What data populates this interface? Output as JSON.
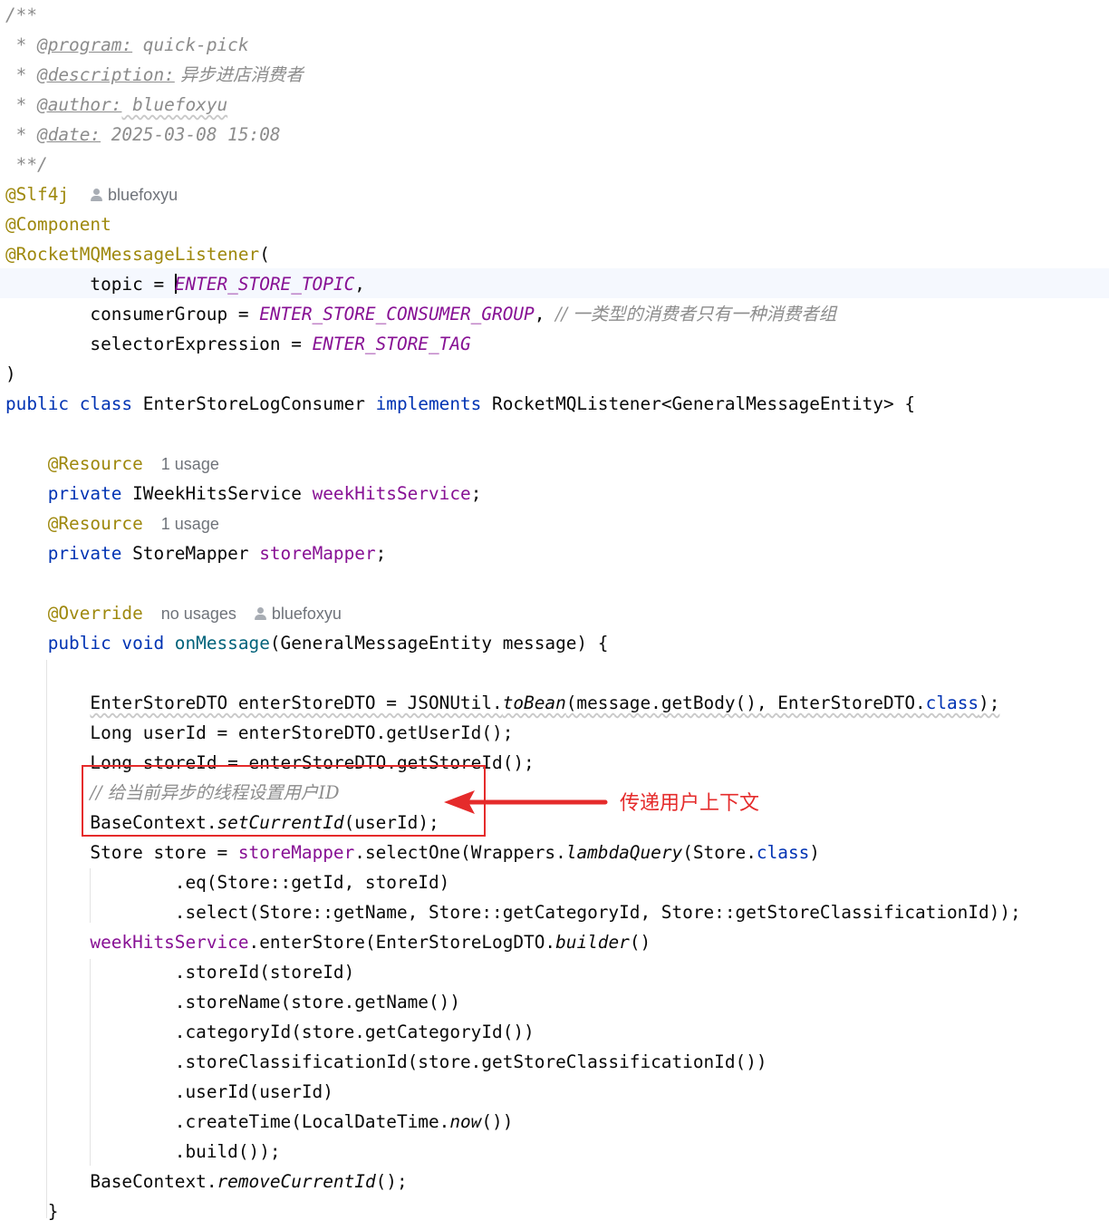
{
  "doc_comment": {
    "open": "/**",
    "star": " * ",
    "program_tag": "@program:",
    "program_value": " quick-pick",
    "description_tag": "@description:",
    "description_value": " 异步进店消费者",
    "author_tag": "@author:",
    "author_value": " bluefoxyu",
    "date_tag": "@date:",
    "date_value": " 2025-03-08 15:08",
    "close": " **/"
  },
  "class_annotations": {
    "slf4j": "@Slf4j",
    "slf4j_author": "bluefoxyu",
    "component": "@Component",
    "listener": "@RocketMQMessageListener",
    "open_paren": "("
  },
  "listener_params": {
    "topic_key": "        topic = ",
    "topic_value": "ENTER_STORE_TOPIC",
    "topic_tail": ",",
    "group_key": "        consumerGroup = ",
    "group_value": "ENTER_STORE_CONSUMER_GROUP",
    "group_tail": ", ",
    "group_comment": "// 一类型的消费者只有一种消费者组",
    "selector_key": "        selectorExpression = ",
    "selector_value": "ENTER_STORE_TAG",
    "close_paren": ")"
  },
  "class_decl": {
    "public_class": "public class",
    "name": " EnterStoreLogConsumer ",
    "implements": "implements",
    "rest": " RocketMQListener<GeneralMessageEntity> {"
  },
  "fields": {
    "indent": "    ",
    "resource": "@Resource",
    "usage": "1 usage",
    "private": "private",
    "type1": " IWeekHitsService ",
    "name1": "weekHitsService",
    "semi": ";",
    "type2": " StoreMapper ",
    "name2": "storeMapper"
  },
  "method": {
    "override": "@Override",
    "usages": "no usages",
    "author": "bluefoxyu",
    "public_void": "public void",
    "name": " onMessage",
    "params": "(GeneralMessageEntity message) {",
    "close_brace": "    }"
  },
  "body": {
    "indent": "        ",
    "deep_indent": "                ",
    "l1_a": "EnterStoreDTO enterStoreDTO = JSONUtil.",
    "l1_b": "toBean",
    "l1_c": "(message.getBody(), EnterStoreDTO.",
    "l1_d": "class",
    "l1_e": ");",
    "l2": "Long userId = enterStoreDTO.getUserId();",
    "l3": "Long storeId = enterStoreDTO.getStoreId();",
    "l4_comment": "// 给当前异步的线程设置用户ID",
    "l5_a": "BaseContext.",
    "l5_b": "setCurrentId",
    "l5_c": "(userId);",
    "l6_a": "Store store = ",
    "l6_b": "storeMapper",
    "l6_c": ".selectOne(Wrappers.",
    "l6_d": "lambdaQuery",
    "l6_e": "(Store.",
    "l6_f": "class",
    "l6_g": ")",
    "l7": ".eq(Store::getId, storeId)",
    "l8": ".select(Store::getName, Store::getCategoryId, Store::getStoreClassificationId));",
    "l9_a": "weekHitsService",
    "l9_b": ".enterStore(EnterStoreLogDTO.",
    "l9_c": "builder",
    "l9_d": "()",
    "l10": ".storeId(storeId)",
    "l11": ".storeName(store.getName())",
    "l12": ".categoryId(store.getCategoryId())",
    "l13": ".storeClassificationId(store.getStoreClassificationId())",
    "l14": ".userId(userId)",
    "l15_a": ".createTime(LocalDateTime.",
    "l15_b": "now",
    "l15_c": "())",
    "l16": ".build());",
    "l17_a": "BaseContext.",
    "l17_b": "removeCurrentId",
    "l17_c": "();"
  },
  "annotation_note": {
    "text": "传递用户上下文",
    "color": "#e52b2b"
  }
}
